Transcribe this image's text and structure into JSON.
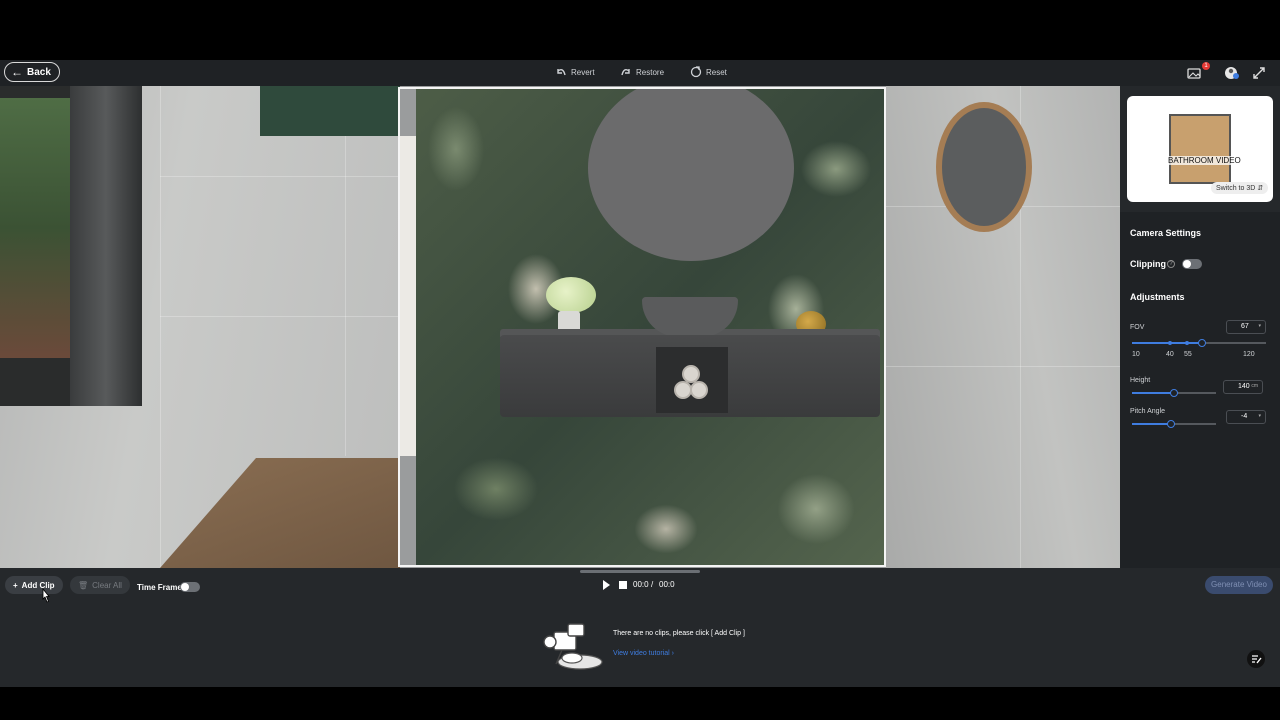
{
  "header": {
    "back_label": "Back",
    "revert_label": "Revert",
    "restore_label": "Restore",
    "reset_label": "Reset",
    "notification_count": "1"
  },
  "minimap": {
    "plan_label": "BATHROOM VIDEO",
    "switch_label": "Switch to 3D"
  },
  "camera_settings": {
    "title": "Camera Settings",
    "clipping_label": "Clipping",
    "clipping_help": "?",
    "adjustments_label": "Adjustments",
    "fov": {
      "label": "FOV",
      "value": "67",
      "ticks": [
        "10",
        "40",
        "55",
        "120"
      ]
    },
    "height": {
      "label": "Height",
      "value": "140",
      "unit": "cm"
    },
    "pitch": {
      "label": "Pitch Angle",
      "value": "-4"
    }
  },
  "timeline": {
    "add_clip_label": "Add Clip",
    "clear_all_label": "Clear All",
    "time_frame_label": "Time Frame",
    "current_time": "00:0",
    "separator": "/",
    "total_time": "00:0",
    "generate_label": "Generate Video",
    "empty_message": "There are no clips, please click [ Add Clip ]",
    "tutorial_link": "View video tutorial"
  },
  "colors": {
    "accent": "#3f7de0",
    "panel_bg": "#1f2225",
    "toolbar_bg": "#1f2225"
  }
}
